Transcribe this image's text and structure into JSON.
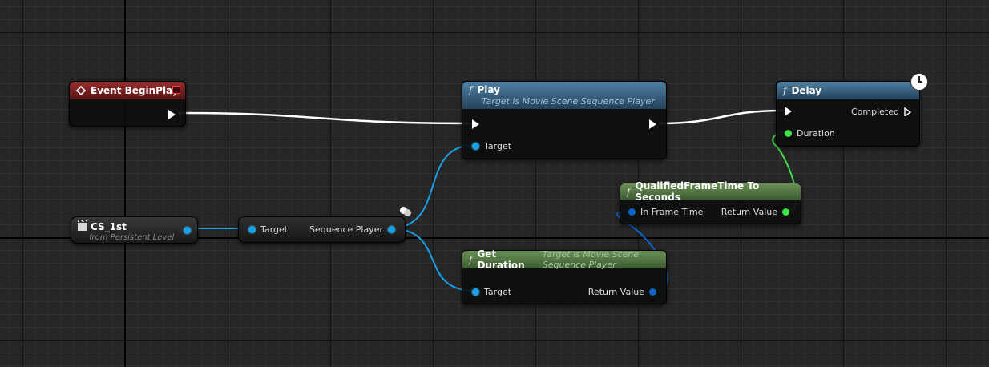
{
  "nodes": {
    "event_begin_play": {
      "title": "Event BeginPlay"
    },
    "cs_1st": {
      "title": "CS_1st",
      "subtitle": "from Persistent Level",
      "icon": "clapperboard-icon"
    },
    "cast": {
      "input_label": "Target",
      "output_label": "Sequence Player"
    },
    "play": {
      "title": "Play",
      "subtitle": "Target is Movie Scene Sequence Player",
      "target_label": "Target"
    },
    "get_duration": {
      "title": "Get Duration",
      "subtitle": "Target is Movie Scene Sequence Player",
      "target_label": "Target",
      "return_label": "Return Value"
    },
    "qualified": {
      "title": "QualifiedFrameTime To Seconds",
      "input_label": "In Frame Time",
      "return_label": "Return Value"
    },
    "delay": {
      "title": "Delay",
      "completed_label": "Completed",
      "duration_label": "Duration",
      "icon": "clock-icon"
    }
  },
  "function_glyph": "f",
  "colors": {
    "exec_wire": "#ffffff",
    "object_wire": "#1aa0e8",
    "struct_wire": "#0f63c4",
    "float_wire": "#3ee043",
    "event_header": "#9a2d2d",
    "function_header": "#4f7fa3",
    "pure_header": "#6a9155"
  }
}
